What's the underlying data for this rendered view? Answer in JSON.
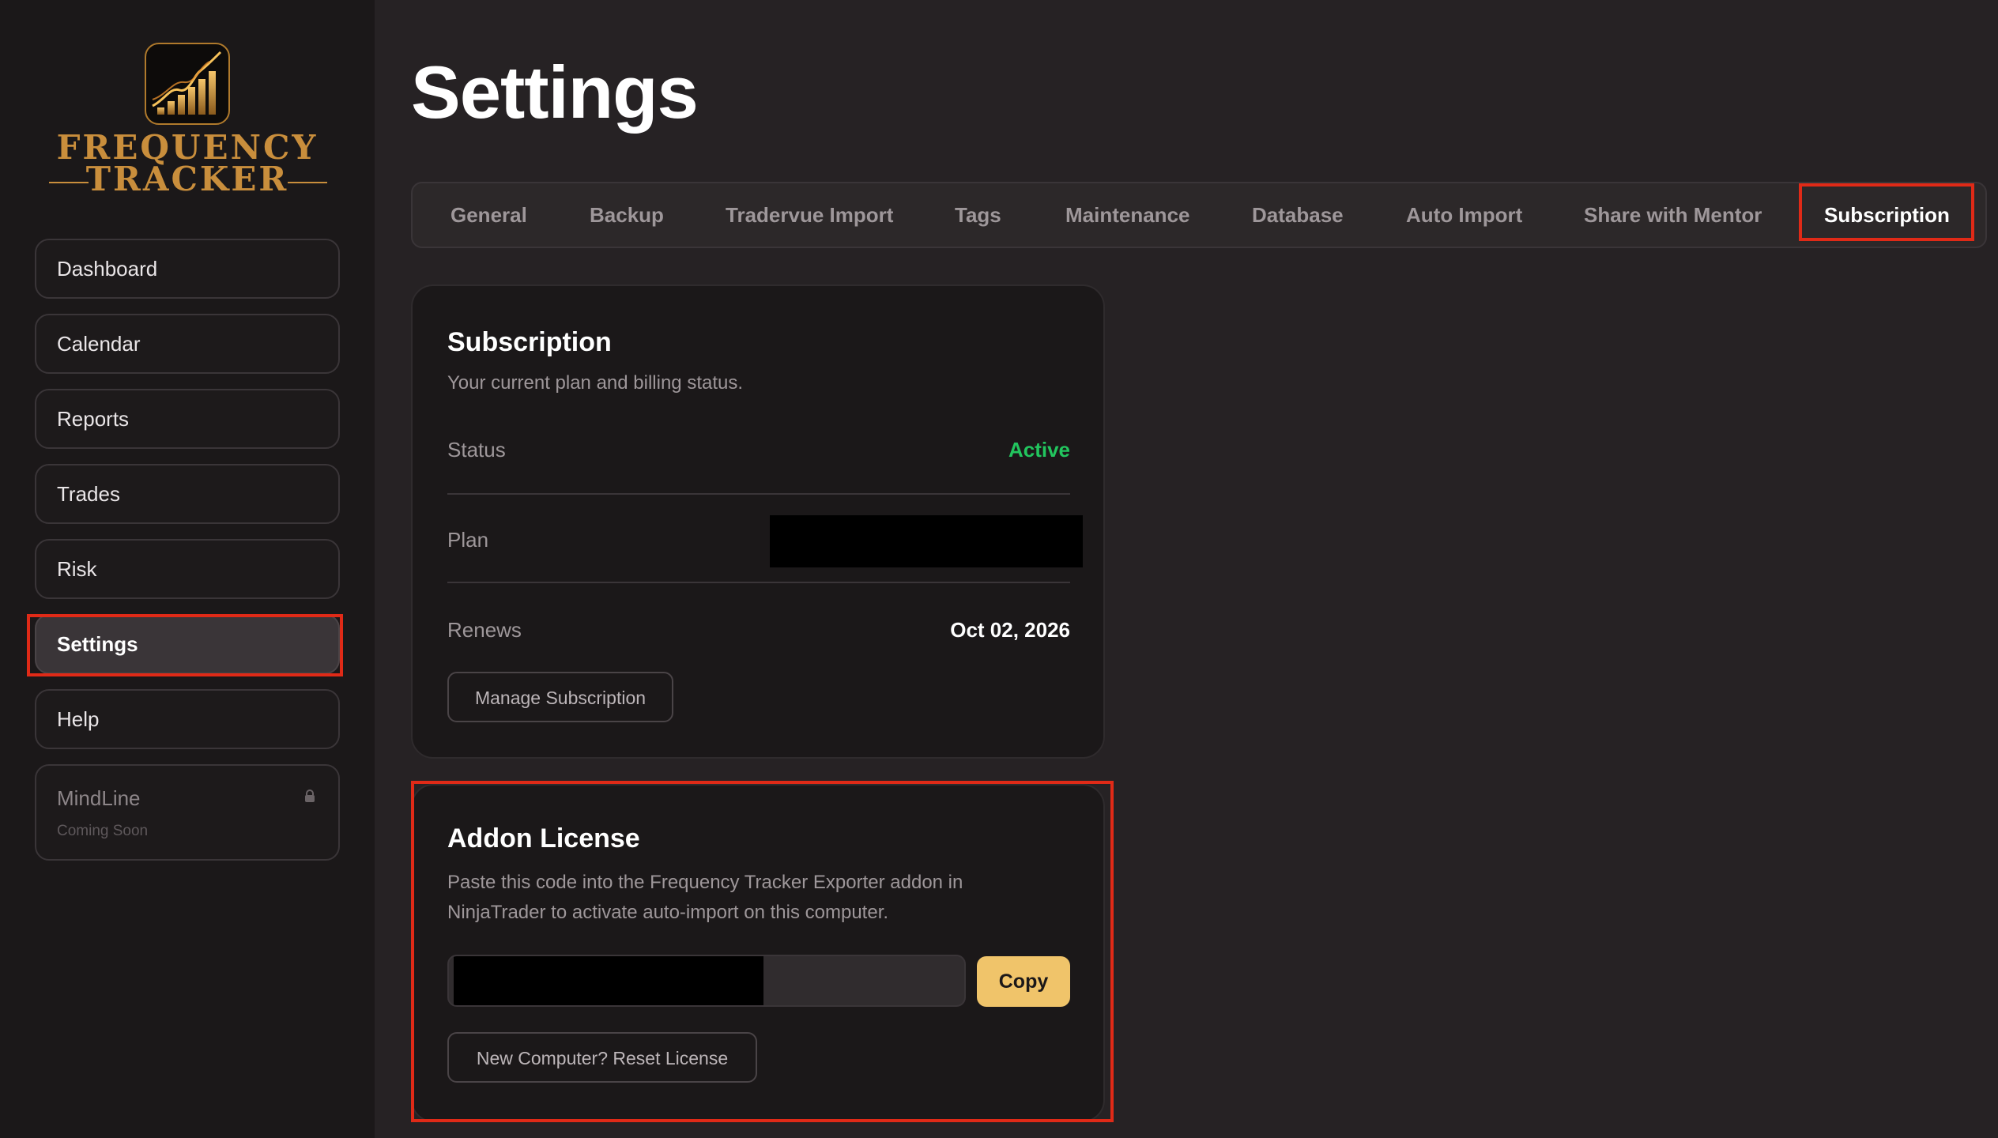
{
  "app": {
    "logo_line1": "FREQUENCY",
    "logo_line2": "TRACKER",
    "logo_icon": "rising-bar-chart-icon",
    "accent_color": "#c98e3c",
    "highlight_color": "#e02a17"
  },
  "sidebar": {
    "items": [
      {
        "label": "Dashboard"
      },
      {
        "label": "Calendar"
      },
      {
        "label": "Reports"
      },
      {
        "label": "Trades"
      },
      {
        "label": "Risk"
      },
      {
        "label": "Settings",
        "active": true
      },
      {
        "label": "Help"
      },
      {
        "label": "MindLine",
        "sublabel": "Coming Soon",
        "locked": true
      }
    ]
  },
  "page": {
    "title": "Settings"
  },
  "tabs": [
    {
      "label": "General"
    },
    {
      "label": "Backup"
    },
    {
      "label": "Tradervue Import"
    },
    {
      "label": "Tags"
    },
    {
      "label": "Maintenance"
    },
    {
      "label": "Database"
    },
    {
      "label": "Auto Import"
    },
    {
      "label": "Share with Mentor"
    },
    {
      "label": "Subscription",
      "active": true
    }
  ],
  "subscription": {
    "title": "Subscription",
    "description": "Your current plan and billing status.",
    "status_label": "Status",
    "status_value": "Active",
    "status_color": "#22c55e",
    "plan_label": "Plan",
    "plan_value_redacted": true,
    "renews_label": "Renews",
    "renews_value": "Oct 02, 2026",
    "manage_button": "Manage Subscription"
  },
  "addon": {
    "title": "Addon License",
    "description_line1": "Paste this code into the Frequency Tracker Exporter addon in",
    "description_line2": "NinjaTrader to activate auto-import on this computer.",
    "license_value_redacted": true,
    "copy_button": "Copy",
    "reset_button": "New Computer? Reset License"
  }
}
